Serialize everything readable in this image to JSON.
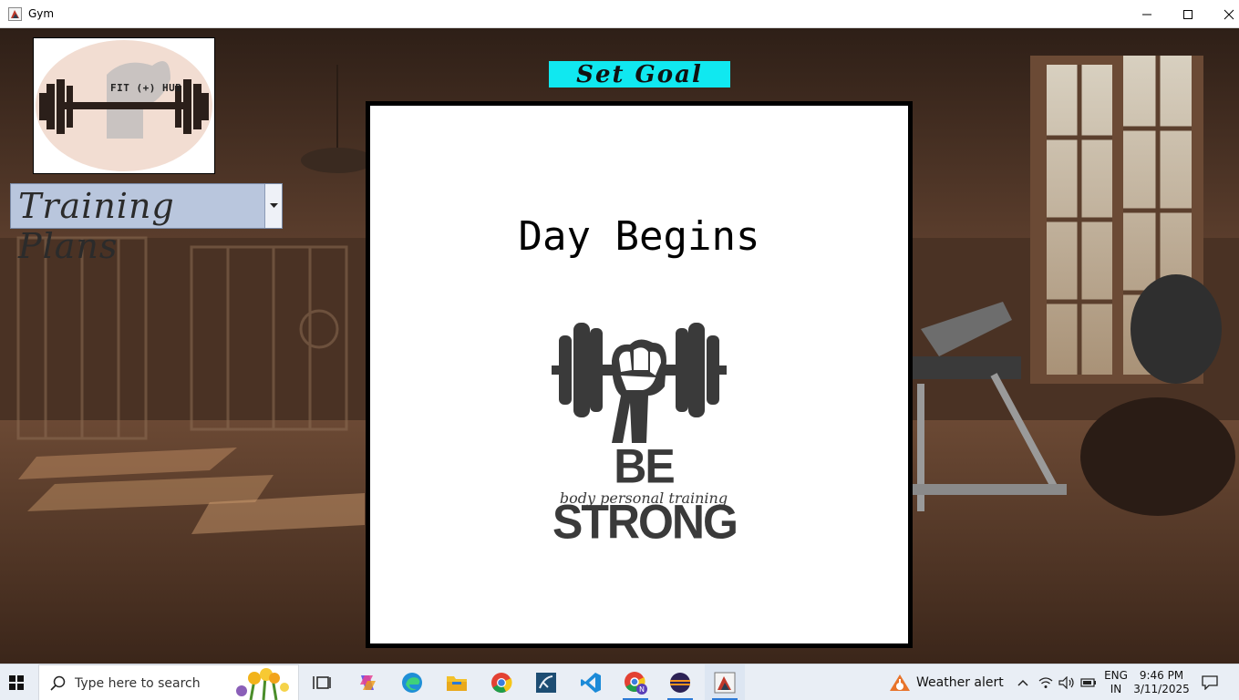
{
  "window": {
    "title": "Gym"
  },
  "logo": {
    "text": "FIT (+) HUB"
  },
  "training_plans": {
    "selected": "Training Plans"
  },
  "set_goal": {
    "label": "Set Goal"
  },
  "panel": {
    "heading": "Day Begins",
    "emblem_title": "BE STRONG",
    "emblem_subtitle": "body personal training"
  },
  "taskbar": {
    "search_placeholder": "Type here to search",
    "apps": [
      "task-view",
      "copilot",
      "edge",
      "file-explorer",
      "chrome",
      "mysql-workbench",
      "vscode",
      "chrome-profile",
      "eclipse",
      "java-gym"
    ],
    "weather_text": "Weather alert",
    "lang_line1": "ENG",
    "lang_line2": "IN",
    "time": "9:46 PM",
    "date": "3/11/2025"
  },
  "colors": {
    "set_goal_bg": "#10e8f0",
    "combo_bg": "#b9c6dd",
    "taskbar_bg": "#e9eef5",
    "accent": "#2d7ad6"
  }
}
